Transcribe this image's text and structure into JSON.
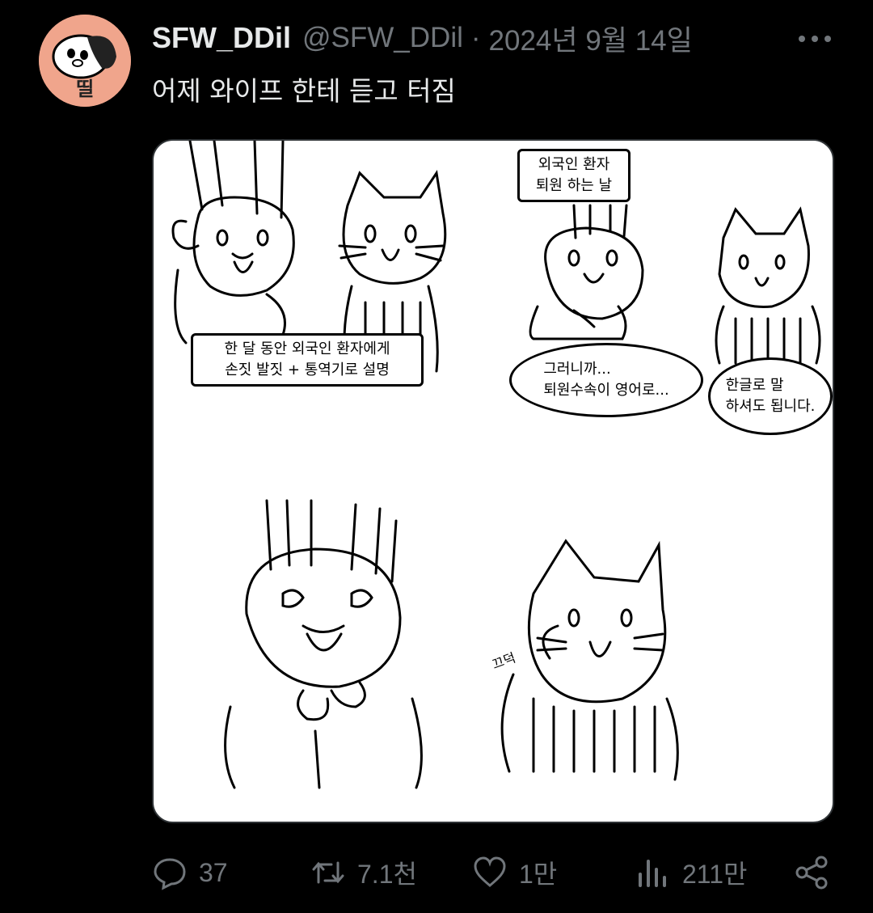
{
  "tweet": {
    "display_name": "SFW_DDil",
    "handle": "@SFW_DDil",
    "separator": "·",
    "date": "2024년 9월 14일",
    "text": "어제 와이프 한테 듣고 터짐"
  },
  "avatar": {
    "label": "띨",
    "bg": "#f0a58c"
  },
  "comic": {
    "panel1_caption": "한 달 동안 외국인 환자에게\n손짓 발짓 + 통역기로 설명",
    "panel2_caption": "외국인 환자\n퇴원 하는 날",
    "panel2_bubble_left": "그러니까...\n퇴원수속이 영어로...",
    "panel2_bubble_right": "한글로 말\n하셔도 됩니다.",
    "panel4_sfx": "끄덕"
  },
  "actions": {
    "replies": "37",
    "retweets": "7.1천",
    "likes": "1만",
    "views": "211만"
  },
  "icons": {
    "reply": "reply-icon",
    "retweet": "retweet-icon",
    "like": "heart-icon",
    "views": "views-icon",
    "share": "share-icon",
    "more": "more-icon"
  }
}
